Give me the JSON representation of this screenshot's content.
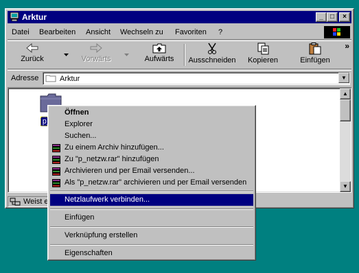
{
  "window": {
    "title": "Arktur",
    "minimize": "_",
    "maximize": "□",
    "close": "×"
  },
  "menubar": {
    "items": [
      "Datei",
      "Bearbeiten",
      "Ansicht",
      "Wechseln zu",
      "Favoriten",
      "?"
    ]
  },
  "toolbar": {
    "back_label": "Zurück",
    "forward_label": "Vorwärts",
    "up_label": "Aufwärts",
    "cut_label": "Ausschneiden",
    "copy_label": "Kopieren",
    "paste_label": "Einfügen",
    "more_label": "»"
  },
  "address": {
    "label": "Adresse",
    "value": "Arktur"
  },
  "content": {
    "folder_name": "p_ne"
  },
  "status": {
    "text": "Weist ei"
  },
  "context_menu": {
    "items": [
      {
        "label": "Öffnen",
        "bold": true
      },
      {
        "label": "Explorer"
      },
      {
        "label": "Suchen..."
      },
      {
        "label": "Zu einem Archiv hinzufügen...",
        "icon": "winrar-icon"
      },
      {
        "label": "Zu \"p_netzw.rar\" hinzufügen",
        "icon": "winrar-icon"
      },
      {
        "label": "Archivieren und per Email versenden...",
        "icon": "winrar-icon"
      },
      {
        "label": "Als \"p_netzw.rar\" archivieren und per Email versenden",
        "icon": "winrar-icon"
      },
      {
        "label": "Netzlaufwerk verbinden...",
        "selected": true
      },
      {
        "label": "Einfügen"
      },
      {
        "label": "Verknüpfung erstellen"
      },
      {
        "label": "Eigenschaften"
      }
    ]
  },
  "colors": {
    "desktop": "#008080",
    "titlebar": "#000080",
    "selection": "#000080",
    "face": "#c0c0c0"
  }
}
